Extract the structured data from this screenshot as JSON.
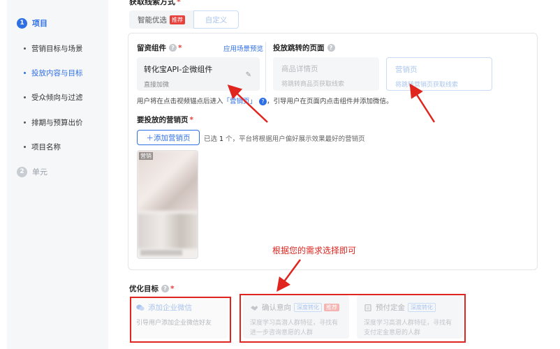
{
  "sidebar": {
    "step1": {
      "num": "1",
      "label": "项目"
    },
    "items": [
      {
        "label": "营销目标与场景"
      },
      {
        "label": "投放内容与目标"
      },
      {
        "label": "受众倾向与过滤"
      },
      {
        "label": "排期与预算出价"
      },
      {
        "label": "项目名称"
      }
    ],
    "step2": {
      "num": "2",
      "label": "单元"
    }
  },
  "main": {
    "title": "获取线索方式",
    "required": "*",
    "tabs": [
      {
        "label": "智能优选",
        "badge": "推荐"
      },
      {
        "label": "自定义"
      }
    ],
    "component": {
      "label": "留资组件",
      "preview_link": "应用场景预览",
      "card_title": "转化宝API-企微组件",
      "card_sub": "直接加微"
    },
    "jump": {
      "label": "投放跳转的页面",
      "cards": [
        {
          "title": "商品详情页",
          "sub": "将跳转商品页获取线索"
        },
        {
          "title": "营销页",
          "sub": "将跳转营销页获取线索"
        }
      ]
    },
    "help": {
      "prefix": "用户将在点击视频锚点后进入",
      "highlight": "「营销页」",
      "suffix": "，引导用户在页面内点击组件并添加微信。"
    },
    "pages": {
      "label": "要投放的营销页",
      "add_button": "＋添加营销页",
      "selected_prefix": "已选",
      "selected_count": "1",
      "selected_suffix": "个，平台将根据用户偏好展示效果最好的营销页",
      "thumb_tag": "营销"
    },
    "annotation": "根据您的需求选择即可",
    "optimize": {
      "label": "优化目标",
      "cards": [
        {
          "title": "添加企业微信",
          "desc": "引导用户添加企业微信好友"
        },
        {
          "title": "确认意向",
          "tag": "深度转化",
          "badge": "推荐",
          "desc": "深度学习高潜人群特征，寻找有进一步咨询意愿的人群"
        },
        {
          "title": "预付定金",
          "tag": "深度转化",
          "desc": "深度学习高潜人群特征，寻找有支付定金意愿的人群"
        }
      ]
    }
  },
  "colors": {
    "accent": "#2f6fe6",
    "annotation": "#e0251f"
  }
}
